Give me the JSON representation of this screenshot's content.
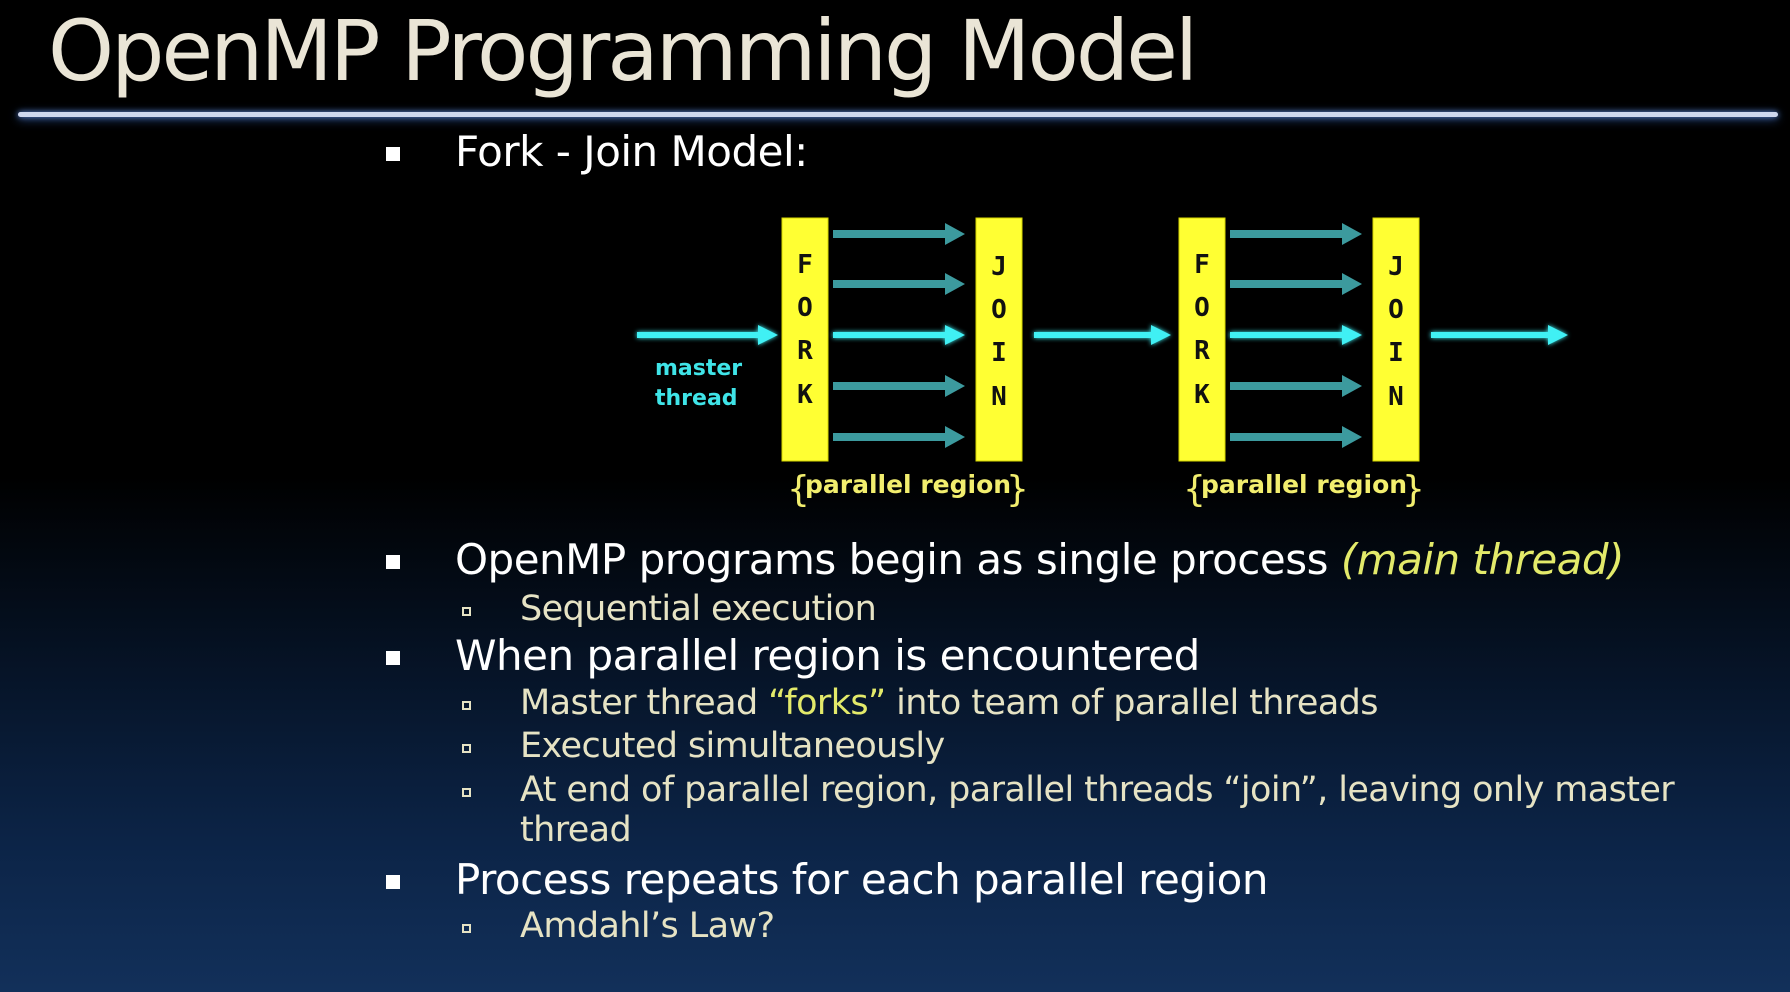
{
  "slide": {
    "title": "OpenMP Programming Model"
  },
  "bullets": {
    "fork_join_heading": "Fork - Join Model:",
    "b2_main": "OpenMP programs begin as single process ",
    "b2_paren_open": "(",
    "b2_highlight": "main thread",
    "b2_paren_close": ")",
    "b2_sub1": "Sequential execution",
    "b3_main": "When parallel region is encountered",
    "b3_sub1_pre": "Master thread ",
    "b3_sub1_highlight": "“forks”",
    "b3_sub1_post": " into team of parallel threads",
    "b3_sub2": "Executed simultaneously",
    "b3_sub3_line1": "At end of parallel region, parallel threads “join”, leaving only master",
    "b3_sub3_line2": "thread",
    "b4_main": "Process repeats for each parallel region",
    "b4_sub1": "Amdahl’s Law?"
  },
  "diagram": {
    "master_thread_line1": "master",
    "master_thread_line2": "thread",
    "fork_letters": [
      "F",
      "O",
      "R",
      "K"
    ],
    "join_letters": [
      "J",
      "O",
      "I",
      "N"
    ],
    "region_label": "parallel region",
    "brace_open": "{",
    "brace_close": "}",
    "colors": {
      "bar": "#ffff33",
      "master_arrow": "#3ff0f4",
      "thread_arrow": "#3c9a9e",
      "label_text": "#3fe4e8",
      "region_text": "#f2ee6e",
      "letter_text": "#111111"
    }
  },
  "colors": {
    "title": "#eae5d6",
    "bullet_text": "#ffffff",
    "sub_text": "#e6e3c4",
    "highlight": "#e3ea6a"
  }
}
